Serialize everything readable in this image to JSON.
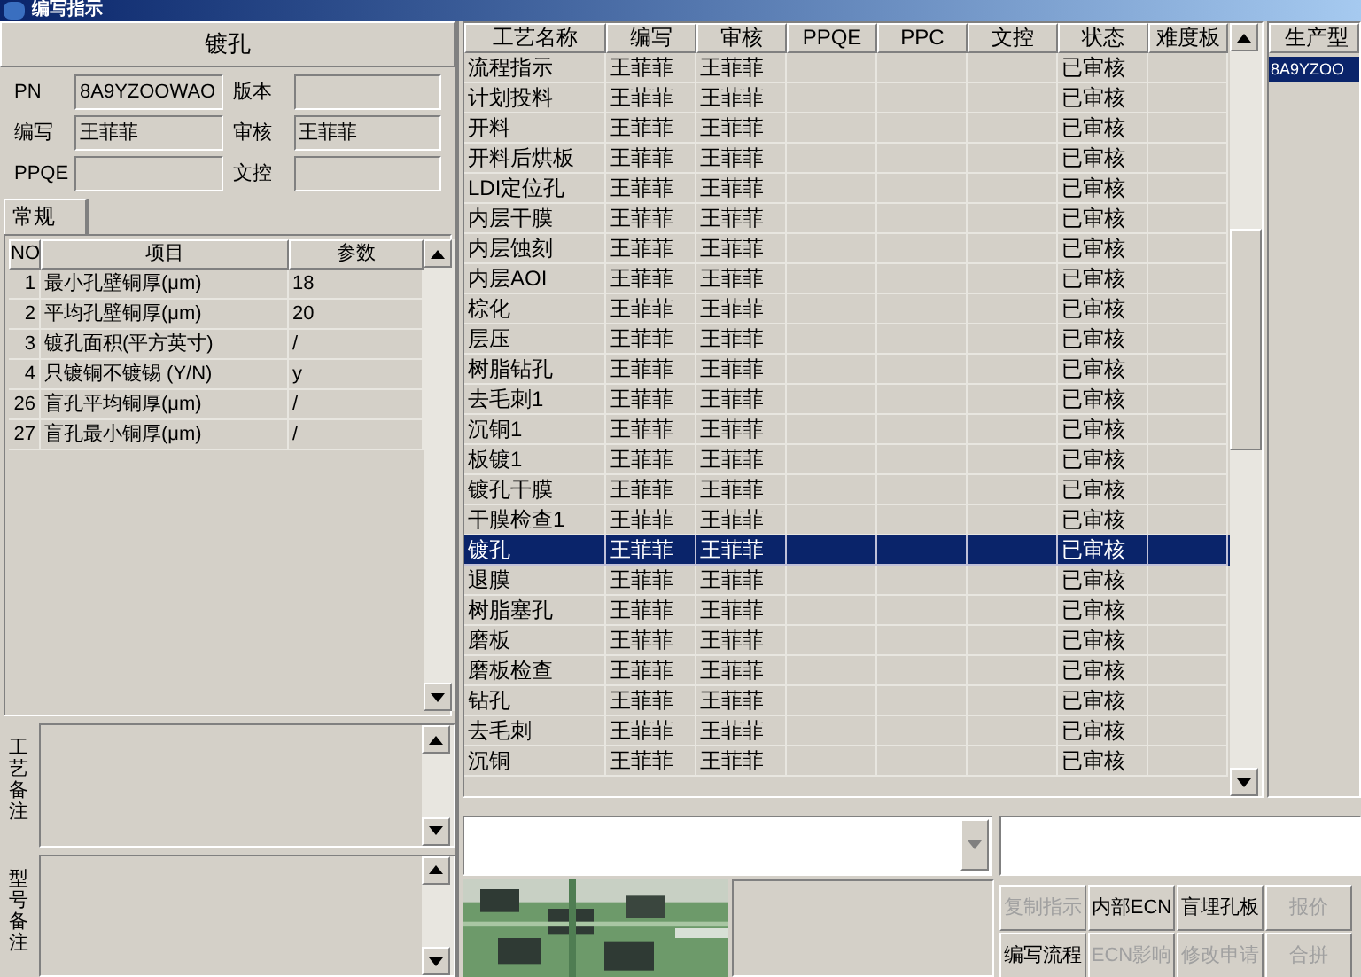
{
  "window": {
    "title": "编写指示"
  },
  "left": {
    "heading": "镀孔",
    "fields": [
      {
        "label": "PN",
        "value": "8A9YZOOWAO"
      },
      {
        "label": "版本"
      },
      {
        "label": "编写",
        "value": "王菲菲"
      },
      {
        "label": "审核",
        "value": "王菲菲"
      },
      {
        "label": "PPQE"
      },
      {
        "label": "文控"
      }
    ],
    "tabs": [
      {
        "label": "常规",
        "selected": true
      }
    ],
    "params": {
      "columns": [
        "NO",
        "项目",
        "参数"
      ],
      "rows": [
        [
          "1",
          "最小孔壁铜厚(μm)",
          "18"
        ],
        [
          "2",
          "平均孔壁铜厚(μm)",
          "20"
        ],
        [
          "3",
          "镀孔面积(平方英寸)",
          "/"
        ],
        [
          "4",
          "只镀铜不镀锡 (Y/N)",
          "y"
        ],
        [
          "26",
          "盲孔平均铜厚(μm)",
          "/"
        ],
        [
          "27",
          "盲孔最小铜厚(μm)",
          "/"
        ]
      ]
    },
    "notes": [
      {
        "label": "工艺备注"
      },
      {
        "label": "型号备注"
      }
    ]
  },
  "process_table": {
    "columns": [
      "工艺名称",
      "编写",
      "审核",
      "PPQE",
      "PPC",
      "文控",
      "状态",
      "难度板"
    ],
    "rows": [
      {
        "cells": [
          "流程指示",
          "王菲菲",
          "王菲菲",
          "",
          "",
          "",
          "已审核",
          ""
        ],
        "selected": false
      },
      {
        "cells": [
          "计划投料",
          "王菲菲",
          "王菲菲",
          "",
          "",
          "",
          "已审核",
          ""
        ],
        "selected": false
      },
      {
        "cells": [
          "开料",
          "王菲菲",
          "王菲菲",
          "",
          "",
          "",
          "已审核",
          ""
        ],
        "selected": false
      },
      {
        "cells": [
          "开料后烘板",
          "王菲菲",
          "王菲菲",
          "",
          "",
          "",
          "已审核",
          ""
        ],
        "selected": false
      },
      {
        "cells": [
          "LDI定位孔",
          "王菲菲",
          "王菲菲",
          "",
          "",
          "",
          "已审核",
          ""
        ],
        "selected": false
      },
      {
        "cells": [
          "内层干膜",
          "王菲菲",
          "王菲菲",
          "",
          "",
          "",
          "已审核",
          ""
        ],
        "selected": false
      },
      {
        "cells": [
          "内层蚀刻",
          "王菲菲",
          "王菲菲",
          "",
          "",
          "",
          "已审核",
          ""
        ],
        "selected": false
      },
      {
        "cells": [
          "内层AOI",
          "王菲菲",
          "王菲菲",
          "",
          "",
          "",
          "已审核",
          ""
        ],
        "selected": false
      },
      {
        "cells": [
          "棕化",
          "王菲菲",
          "王菲菲",
          "",
          "",
          "",
          "已审核",
          ""
        ],
        "selected": false
      },
      {
        "cells": [
          "层压",
          "王菲菲",
          "王菲菲",
          "",
          "",
          "",
          "已审核",
          ""
        ],
        "selected": false
      },
      {
        "cells": [
          "树脂钻孔",
          "王菲菲",
          "王菲菲",
          "",
          "",
          "",
          "已审核",
          ""
        ],
        "selected": false
      },
      {
        "cells": [
          "去毛刺1",
          "王菲菲",
          "王菲菲",
          "",
          "",
          "",
          "已审核",
          ""
        ],
        "selected": false
      },
      {
        "cells": [
          "沉铜1",
          "王菲菲",
          "王菲菲",
          "",
          "",
          "",
          "已审核",
          ""
        ],
        "selected": false
      },
      {
        "cells": [
          "板镀1",
          "王菲菲",
          "王菲菲",
          "",
          "",
          "",
          "已审核",
          ""
        ],
        "selected": false
      },
      {
        "cells": [
          "镀孔干膜",
          "王菲菲",
          "王菲菲",
          "",
          "",
          "",
          "已审核",
          ""
        ],
        "selected": false
      },
      {
        "cells": [
          "干膜检查1",
          "王菲菲",
          "王菲菲",
          "",
          "",
          "",
          "已审核",
          ""
        ],
        "selected": false
      },
      {
        "cells": [
          "镀孔",
          "王菲菲",
          "王菲菲",
          "",
          "",
          "",
          "已审核",
          ""
        ],
        "selected": true
      },
      {
        "cells": [
          "退膜",
          "王菲菲",
          "王菲菲",
          "",
          "",
          "",
          "已审核",
          ""
        ],
        "selected": false
      },
      {
        "cells": [
          "树脂塞孔",
          "王菲菲",
          "王菲菲",
          "",
          "",
          "",
          "已审核",
          ""
        ],
        "selected": false
      },
      {
        "cells": [
          "磨板",
          "王菲菲",
          "王菲菲",
          "",
          "",
          "",
          "已审核",
          ""
        ],
        "selected": false
      },
      {
        "cells": [
          "磨板检查",
          "王菲菲",
          "王菲菲",
          "",
          "",
          "",
          "已审核",
          ""
        ],
        "selected": false
      },
      {
        "cells": [
          "钻孔",
          "王菲菲",
          "王菲菲",
          "",
          "",
          "",
          "已审核",
          ""
        ],
        "selected": false
      },
      {
        "cells": [
          "去毛刺",
          "王菲菲",
          "王菲菲",
          "",
          "",
          "",
          "已审核",
          ""
        ],
        "selected": false
      },
      {
        "cells": [
          "沉铜",
          "王菲菲",
          "王菲菲",
          "",
          "",
          "",
          "已审核",
          ""
        ],
        "selected": false
      }
    ]
  },
  "model_list": {
    "column": "生产型",
    "items": [
      {
        "label": "8A9YZOO",
        "selected": true
      }
    ]
  },
  "buttons": [
    {
      "label": "复制指示",
      "disabled": true
    },
    {
      "label": "内部ECN",
      "disabled": false
    },
    {
      "label": "盲埋孔板",
      "disabled": false
    },
    {
      "label": "报价",
      "disabled": true
    },
    {
      "label": "编写流程",
      "disabled": false
    },
    {
      "label": "ECN影响",
      "disabled": true
    },
    {
      "label": "修改申请",
      "disabled": true
    },
    {
      "label": "合拼",
      "disabled": true
    }
  ]
}
